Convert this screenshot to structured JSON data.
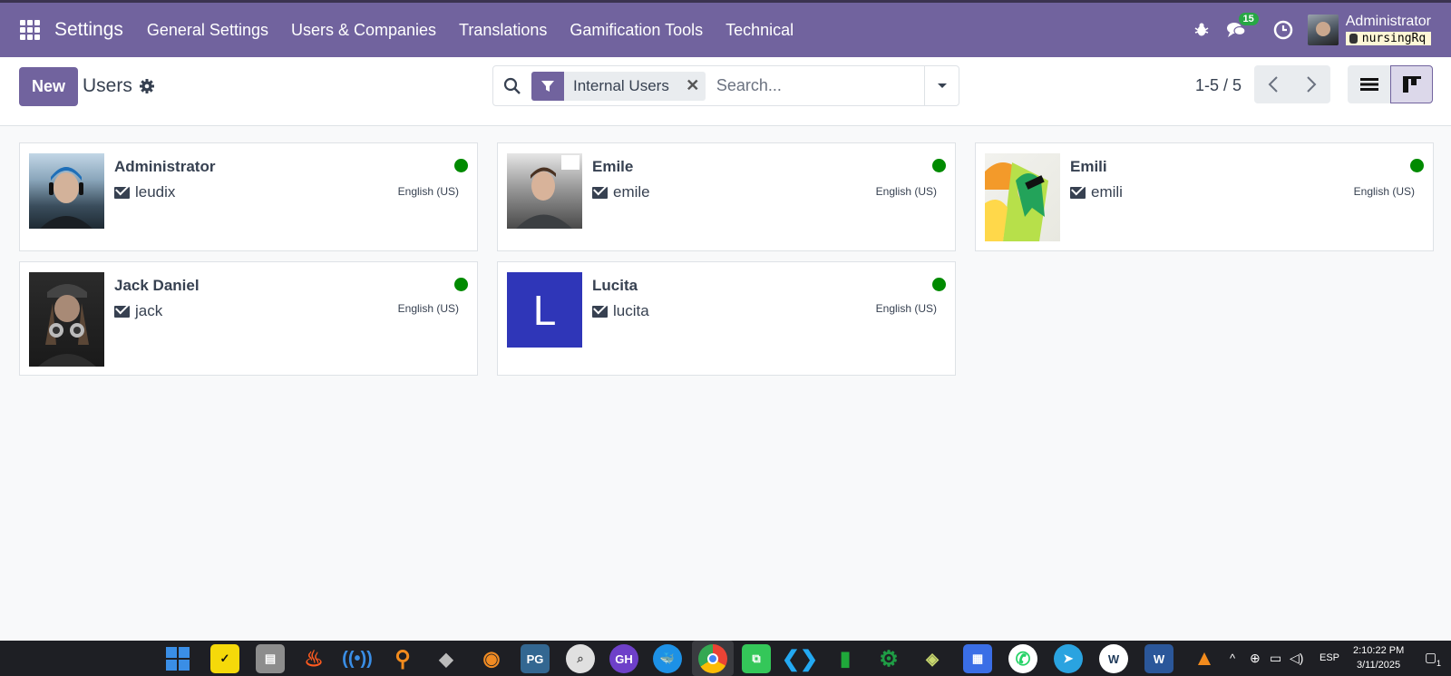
{
  "navbar": {
    "brand": "Settings",
    "menu": [
      "General Settings",
      "Users & Companies",
      "Translations",
      "Gamification Tools",
      "Technical"
    ],
    "messages_count": "15",
    "user_name": "Administrator",
    "database": "nursingRq"
  },
  "control": {
    "new_label": "New",
    "breadcrumb": "Users",
    "facet_label": "Internal Users",
    "search_placeholder": "Search...",
    "pager": "1-5 / 5"
  },
  "users": [
    {
      "name": "Administrator",
      "login": "leudix",
      "lang": "English (US)",
      "online": true
    },
    {
      "name": "Emile",
      "login": "emile",
      "lang": "English (US)",
      "online": true
    },
    {
      "name": "Emili",
      "login": "emili",
      "lang": "English (US)",
      "online": true
    },
    {
      "name": "Jack Daniel",
      "login": "jack",
      "lang": "English (US)",
      "online": true
    },
    {
      "name": "Lucita",
      "login": "lucita",
      "lang": "English (US)",
      "online": true,
      "initial": "L"
    }
  ],
  "taskbar": {
    "language": "ESP",
    "time": "2:10:22 PM",
    "date": "3/11/2025",
    "notifications": "1"
  },
  "colors": {
    "brand": "#71639e",
    "online": "#008a00",
    "avatar_letter_bg": "#2f36b8"
  }
}
